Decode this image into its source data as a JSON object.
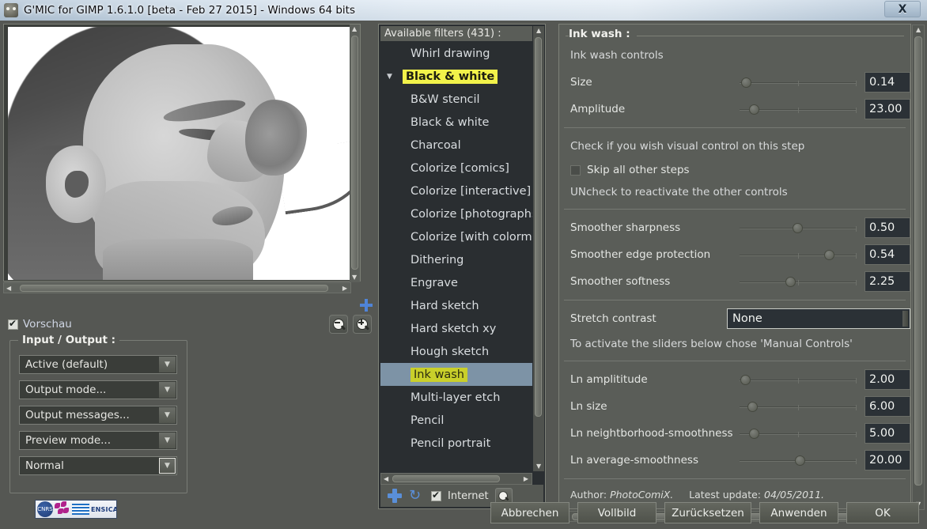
{
  "window": {
    "title": "G'MIC for GIMP 1.6.1.0 [beta - Feb 27 2015] - Windows 64 bits",
    "close_label": "X",
    "app_icon": "gmic-icon"
  },
  "preview": {
    "checkbox_label": "Vorschau",
    "checkbox_checked": true,
    "zoom_out_label": "-",
    "zoom_in_label": "+",
    "image_description": "ink-wash grayscale portrait of a child in profile smelling a flower"
  },
  "input_output": {
    "legend": "Input / Output :",
    "combos": [
      {
        "value": "Active (default)",
        "name": "input-layers-combo"
      },
      {
        "value": "Output mode...",
        "name": "output-mode-combo"
      },
      {
        "value": "Output messages...",
        "name": "output-messages-combo"
      },
      {
        "value": "Preview mode...",
        "name": "preview-mode-combo"
      },
      {
        "value": "Normal",
        "name": "preview-size-combo"
      }
    ]
  },
  "logo": {
    "cnrs": "CNRS",
    "ensicaen": "ENSICAEN"
  },
  "filters": {
    "header": "Available filters (431) :",
    "items": [
      {
        "label": "Whirl drawing",
        "type": "filter"
      },
      {
        "label": "Black & white",
        "type": "category",
        "expanded": true
      },
      {
        "label": "B&W stencil",
        "type": "filter"
      },
      {
        "label": "Black & white",
        "type": "filter"
      },
      {
        "label": "Charcoal",
        "type": "filter"
      },
      {
        "label": "Colorize [comics]",
        "type": "filter"
      },
      {
        "label": "Colorize [interactive]",
        "type": "filter"
      },
      {
        "label": "Colorize [photographs]",
        "type": "filter"
      },
      {
        "label": "Colorize [with colormap]",
        "type": "filter"
      },
      {
        "label": "Dithering",
        "type": "filter"
      },
      {
        "label": "Engrave",
        "type": "filter"
      },
      {
        "label": "Hard sketch",
        "type": "filter"
      },
      {
        "label": "Hard sketch xy",
        "type": "filter"
      },
      {
        "label": "Hough sketch",
        "type": "filter"
      },
      {
        "label": "Ink wash",
        "type": "filter",
        "selected": true
      },
      {
        "label": "Multi-layer etch",
        "type": "filter"
      },
      {
        "label": "Pencil",
        "type": "filter"
      },
      {
        "label": "Pencil portrait",
        "type": "filter"
      }
    ],
    "toolbar": {
      "add_label": "+",
      "refresh_label": "↻",
      "internet_label": "Internet",
      "internet_checked": true,
      "search_label": "search-icon"
    }
  },
  "params": {
    "legend": "Ink wash :",
    "section1_title": "Ink wash controls",
    "rows1": [
      {
        "label": "Size",
        "value": "0.14",
        "knob_pct": 2
      },
      {
        "label": "Amplitude",
        "value": "23.00",
        "knob_pct": 9
      }
    ],
    "check_hint": "Check if you wish visual control on this step",
    "skip_label": "Skip all other steps",
    "skip_checked": false,
    "uncheck_hint": "UNcheck to reactivate the other controls",
    "rows2": [
      {
        "label": "Smoother sharpness",
        "value": "0.50",
        "knob_pct": 50
      },
      {
        "label": "Smoother edge protection",
        "value": "0.54",
        "knob_pct": 81
      },
      {
        "label": "Smoother softness",
        "value": "2.25",
        "knob_pct": 43
      }
    ],
    "stretch_label": "Stretch contrast",
    "stretch_value": "None",
    "manual_hint": "To activate the sliders below chose 'Manual Controls'",
    "rows3": [
      {
        "label": "Ln amplititude",
        "value": "2.00",
        "knob_pct": 1
      },
      {
        "label": "Ln size",
        "value": "6.00",
        "knob_pct": 8
      },
      {
        "label": "Ln neightborhood-smoothness",
        "value": "5.00",
        "knob_pct": 9
      },
      {
        "label": "Ln average-smoothness",
        "value": "20.00",
        "knob_pct": 50
      }
    ],
    "author_prefix": "Author:",
    "author_name": "PhotoComiX.",
    "update_prefix": "Latest update:",
    "update_date": "04/05/2011."
  },
  "buttons": [
    {
      "label": "Abbrechen",
      "mnemonic": "A",
      "name": "cancel-button",
      "primary": false
    },
    {
      "label": "Vollbild",
      "mnemonic": "V",
      "name": "fullscreen-button",
      "primary": false
    },
    {
      "label": "Zurücksetzen",
      "mnemonic": "Z",
      "name": "reset-button",
      "primary": false
    },
    {
      "label": "Anwenden",
      "mnemonic": "w",
      "name": "apply-button",
      "primary": false
    },
    {
      "label": "OK",
      "mnemonic": "O",
      "name": "ok-button",
      "primary": true
    }
  ],
  "colors": {
    "dialog_bg": "#555753",
    "list_bg": "#2a2e31",
    "selection": "#7d93a6",
    "highlight_yellow": "#f2f24a",
    "ok_olive": "#85860a",
    "value_field": "#2b3136"
  }
}
